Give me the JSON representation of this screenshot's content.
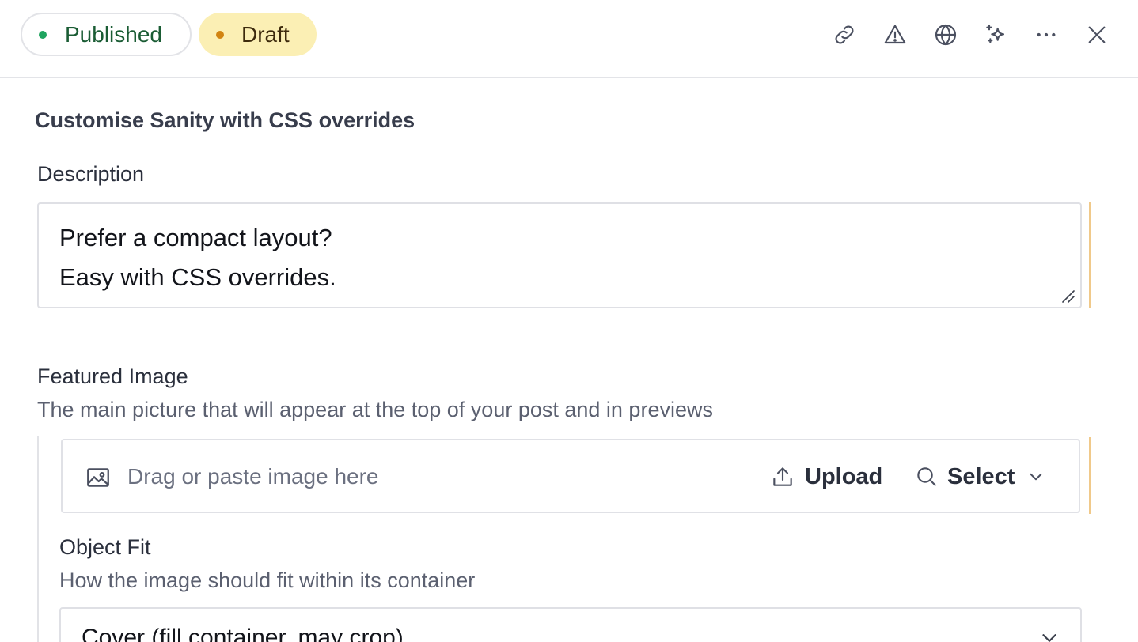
{
  "header": {
    "status_published": "Published",
    "status_draft": "Draft",
    "icons": [
      "link-icon",
      "warning-icon",
      "globe-icon",
      "sparkles-icon",
      "more-icon",
      "close-icon"
    ],
    "colors": {
      "published_dot": "#1fa45f",
      "published_text": "#1a5c34",
      "draft_bg": "#fbefb4",
      "draft_dot": "#d18412"
    }
  },
  "document": {
    "title": "Customise Sanity with CSS overrides"
  },
  "fields": {
    "description": {
      "label": "Description",
      "lines": [
        "Prefer a compact layout?",
        "Easy with CSS overrides."
      ]
    },
    "featured_image": {
      "label": "Featured Image",
      "description": "The main picture that will appear at the top of your post and in previews",
      "dropzone_text": "Drag or paste image here",
      "upload_label": "Upload",
      "select_label": "Select"
    },
    "object_fit": {
      "label": "Object Fit",
      "description": "How the image should fit within its container",
      "selected": "Cover (fill container, may crop)"
    }
  },
  "change_indicator_color": "#f0c98a"
}
